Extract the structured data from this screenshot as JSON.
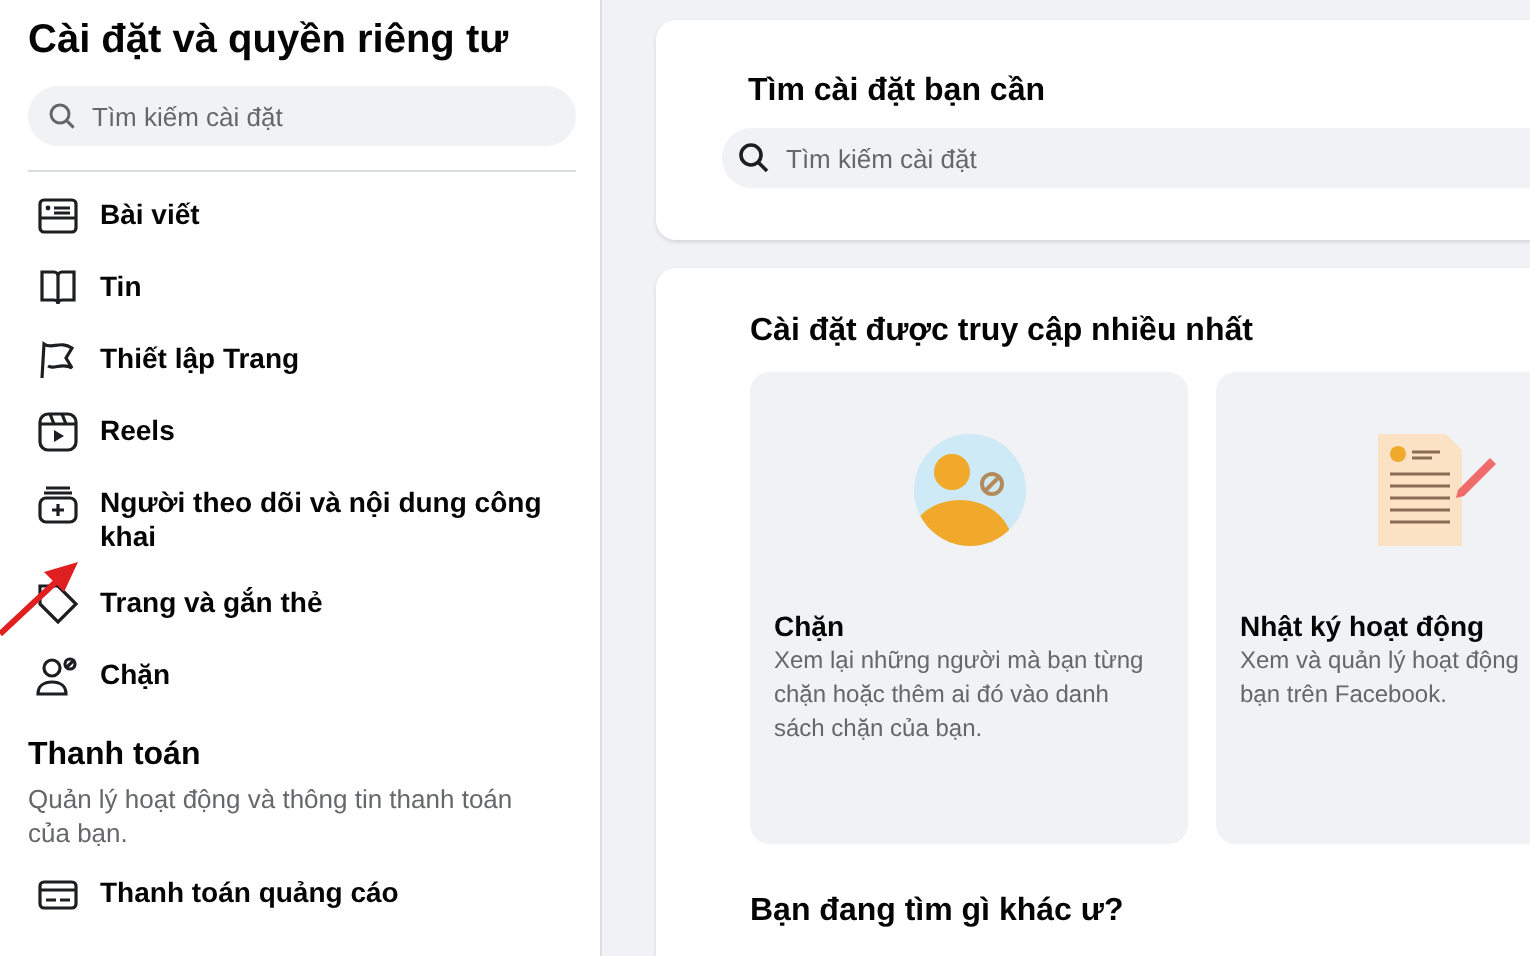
{
  "sidebar": {
    "title": "Cài đặt và quyền riêng tư",
    "search": {
      "placeholder": "Tìm kiếm cài đặt"
    },
    "items": [
      {
        "kind": "post",
        "label": "Bài viết"
      },
      {
        "kind": "story",
        "label": "Tin"
      },
      {
        "kind": "flag",
        "label": "Thiết lập Trang"
      },
      {
        "kind": "reels",
        "label": "Reels"
      },
      {
        "kind": "followers",
        "label": "Người theo dõi và nội dung công khai"
      },
      {
        "kind": "tag",
        "label": "Trang và gắn thẻ"
      },
      {
        "kind": "block",
        "label": "Chặn"
      }
    ],
    "sections": [
      {
        "title": "Thanh toán",
        "description": "Quản lý hoạt động và thông tin thanh toán của bạn.",
        "items": [
          {
            "kind": "card",
            "label": "Thanh toán quảng cáo"
          }
        ]
      }
    ]
  },
  "search_card": {
    "title": "Tìm cài đặt bạn cần",
    "placeholder": "Tìm kiếm cài đặt"
  },
  "frequent": {
    "title": "Cài đặt được truy cập nhiều nhất",
    "cards": [
      {
        "kind": "block",
        "title": "Chặn",
        "description": "Xem lại những người mà bạn từng chặn hoặc thêm ai đó vào danh sách chặn của bạn."
      },
      {
        "kind": "log",
        "title": "Nhật ký hoạt động",
        "description": "Xem và quản lý hoạt động\nbạn trên Facebook."
      }
    ]
  },
  "other_heading": "Bạn đang tìm gì khác ư?"
}
